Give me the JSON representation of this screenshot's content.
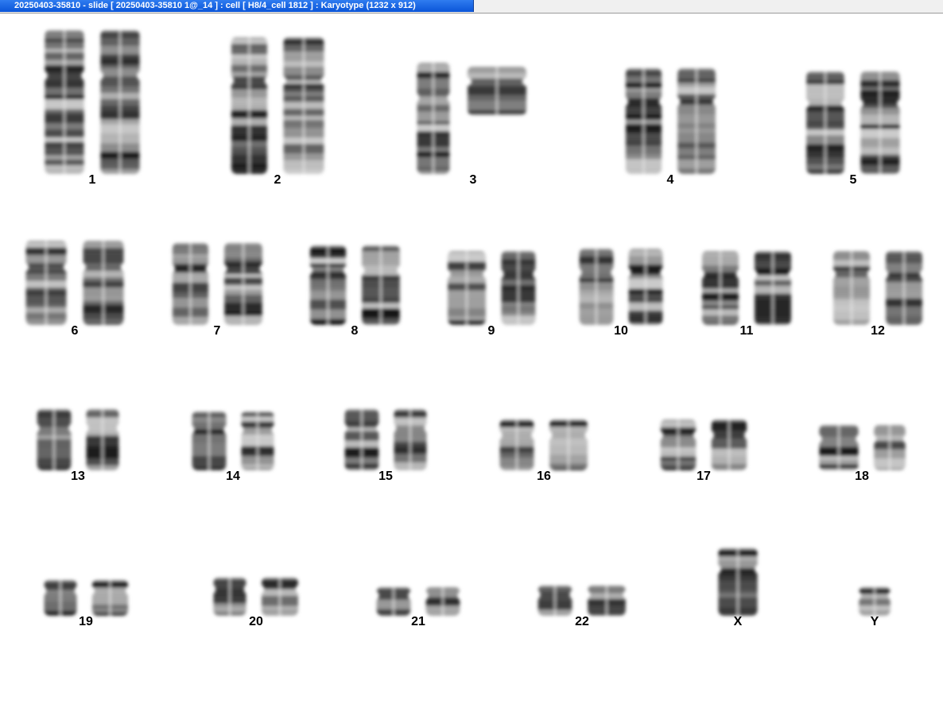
{
  "window": {
    "title": "20250403-35810 - slide [ 20250403-35810 1@_14 ] : cell [ H8/4_cell 1812 ] : Karyotype  (1232 x 912)"
  },
  "karyotype": {
    "rows": [
      {
        "chromosomes": [
          {
            "label": "1",
            "sizeRel": 1.0
          },
          {
            "label": "2",
            "sizeRel": 0.95
          },
          {
            "label": "3",
            "sizeRel": 0.78
          },
          {
            "label": "4",
            "sizeRel": 0.74
          },
          {
            "label": "5",
            "sizeRel": 0.72
          }
        ]
      },
      {
        "chromosomes": [
          {
            "label": "6",
            "sizeRel": 0.68
          },
          {
            "label": "7",
            "sizeRel": 0.66
          },
          {
            "label": "8",
            "sizeRel": 0.64
          },
          {
            "label": "9",
            "sizeRel": 0.6
          },
          {
            "label": "10",
            "sizeRel": 0.62
          },
          {
            "label": "11",
            "sizeRel": 0.6
          },
          {
            "label": "12",
            "sizeRel": 0.6
          }
        ]
      },
      {
        "chromosomes": [
          {
            "label": "13",
            "sizeRel": 0.5
          },
          {
            "label": "14",
            "sizeRel": 0.48
          },
          {
            "label": "15",
            "sizeRel": 0.5
          },
          {
            "label": "16",
            "sizeRel": 0.42
          },
          {
            "label": "17",
            "sizeRel": 0.42
          },
          {
            "label": "18",
            "sizeRel": 0.38
          }
        ]
      },
      {
        "chromosomes": [
          {
            "label": "19",
            "sizeRel": 0.3
          },
          {
            "label": "20",
            "sizeRel": 0.32
          },
          {
            "label": "21",
            "sizeRel": 0.24
          },
          {
            "label": "22",
            "sizeRel": 0.26
          },
          {
            "label": "X",
            "sizeRel": 0.55,
            "copies": 1
          },
          {
            "label": "Y",
            "sizeRel": 0.25,
            "copies": 1
          }
        ]
      }
    ]
  }
}
